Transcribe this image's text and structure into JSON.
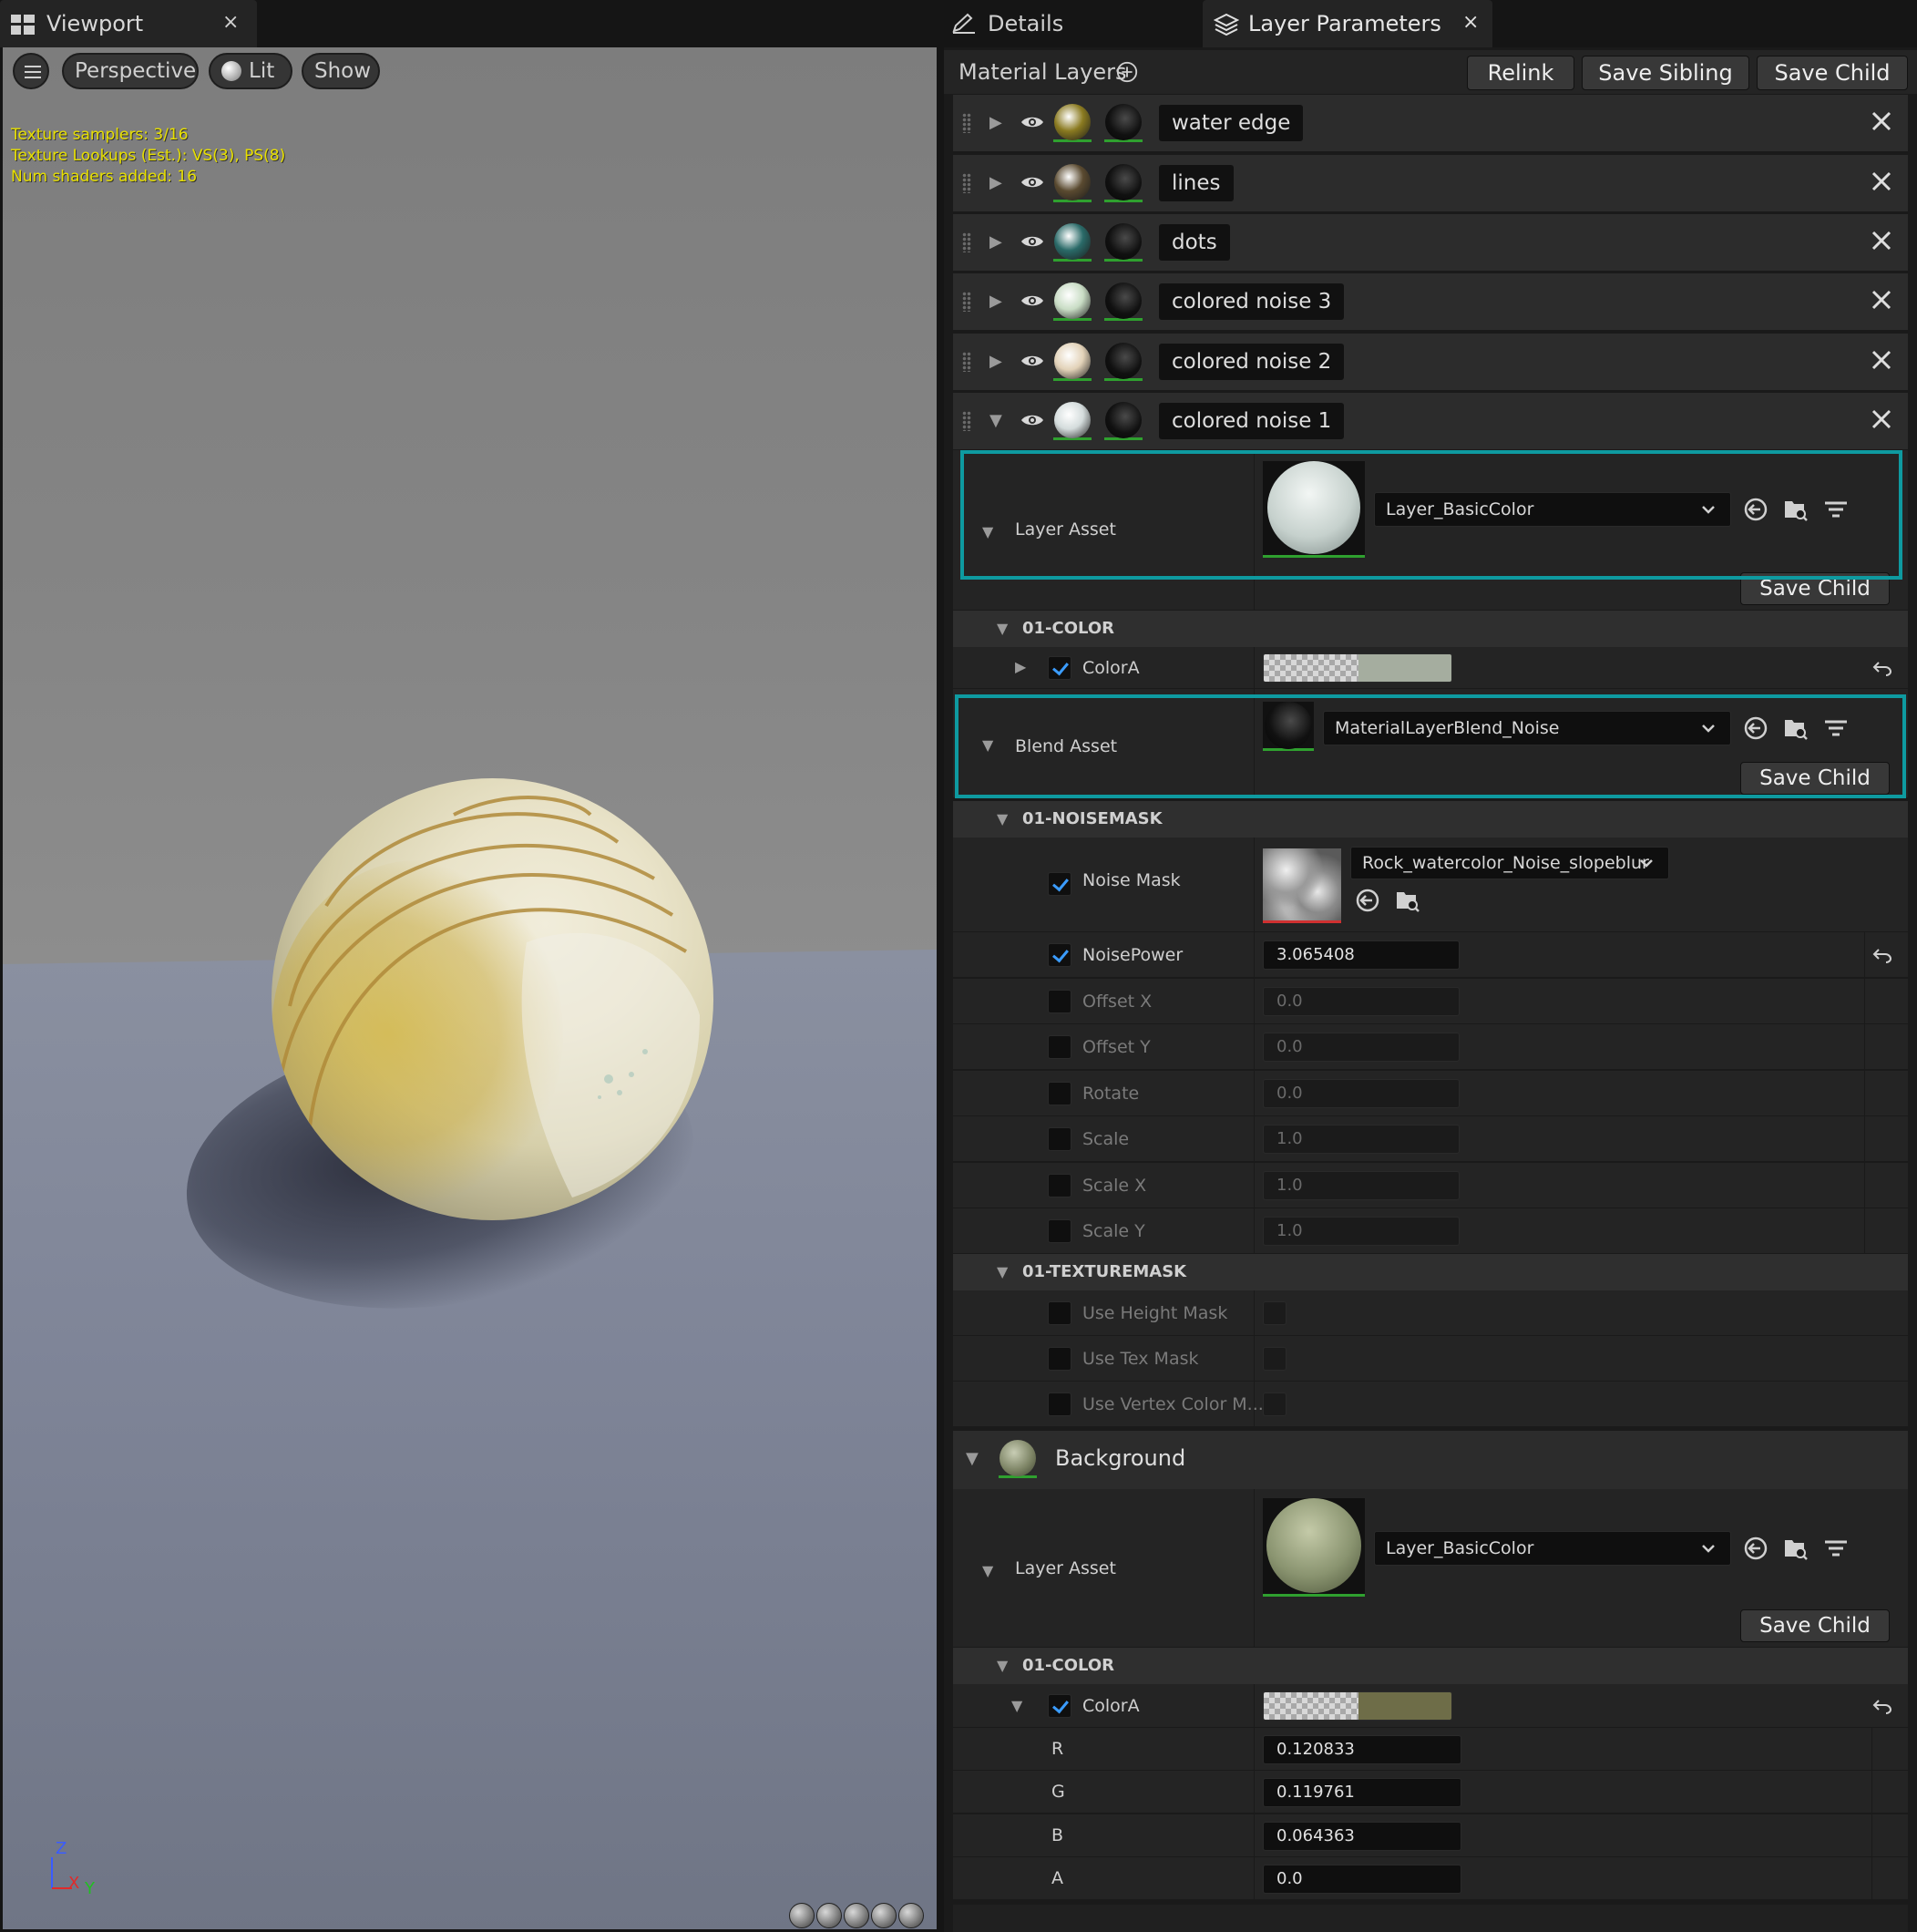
{
  "viewport": {
    "tab_label": "Viewport",
    "tab_close": "×",
    "toolbar": {
      "perspective": "Perspective",
      "lit": "Lit",
      "show": "Show"
    },
    "stats": [
      "Texture samplers: 3/16",
      "Texture Lookups (Est.): VS(3), PS(8)",
      "Num shaders added: 16"
    ],
    "axis": {
      "z": "Z",
      "x": "X",
      "y": "Y"
    }
  },
  "tabs": {
    "details": "Details",
    "layer_parameters": "Layer Parameters",
    "close": "×"
  },
  "material_layers": {
    "title": "Material Layers",
    "relink": "Relink",
    "save_sibling": "Save Sibling",
    "save_child": "Save Child",
    "layers": [
      {
        "name": "water edge",
        "color": "#8a7a20"
      },
      {
        "name": "lines",
        "color": "#5a4a30"
      },
      {
        "name": "dots",
        "color": "#2a6a68"
      },
      {
        "name": "colored noise 3",
        "color": "#c8dcc4"
      },
      {
        "name": "colored noise 2",
        "color": "#e2d2b8"
      },
      {
        "name": "colored noise 1",
        "color": "#d4dcdc"
      }
    ]
  },
  "layer1": {
    "layer_asset_label": "Layer Asset",
    "layer_asset_value": "Layer_BasicColor",
    "save_child": "Save Child",
    "color_category": "01-COLOR",
    "colorA_label": "ColorA",
    "colorA_swatch": "#a5ad9f",
    "blend_asset_label": "Blend Asset",
    "blend_asset_value": "MaterialLayerBlend_Noise",
    "noisemask_category": "01-NOISEMASK",
    "noise_mask_label": "Noise Mask",
    "noise_mask_value": "Rock_watercolor_Noise_slopeblur",
    "params": [
      {
        "label": "NoisePower",
        "value": "3.065408",
        "checked": true
      },
      {
        "label": "Offset X",
        "value": "0.0",
        "checked": false
      },
      {
        "label": "Offset Y",
        "value": "0.0",
        "checked": false
      },
      {
        "label": "Rotate",
        "value": "0.0",
        "checked": false
      },
      {
        "label": "Scale",
        "value": "1.0",
        "checked": false
      },
      {
        "label": "Scale X",
        "value": "1.0",
        "checked": false
      },
      {
        "label": "Scale Y",
        "value": "1.0",
        "checked": false
      }
    ],
    "texturemask_category": "01-TEXTUREMASK",
    "texmask_params": [
      {
        "label": "Use Height Mask"
      },
      {
        "label": "Use Tex Mask"
      },
      {
        "label": "Use Vertex Color M..."
      }
    ]
  },
  "background": {
    "title": "Background",
    "layer_asset_label": "Layer Asset",
    "layer_asset_value": "Layer_BasicColor",
    "save_child": "Save Child",
    "color_category": "01-COLOR",
    "colorA_label": "ColorA",
    "colorA_swatch": "#6e6d48",
    "channels": [
      {
        "label": "R",
        "value": "0.120833"
      },
      {
        "label": "G",
        "value": "0.119761"
      },
      {
        "label": "B",
        "value": "0.064363"
      },
      {
        "label": "A",
        "value": "0.0"
      }
    ]
  },
  "colors": {
    "selection_outline": "#0e9aa0",
    "checkbox_check": "#3b9cff",
    "stats_text": "#e8e000"
  }
}
